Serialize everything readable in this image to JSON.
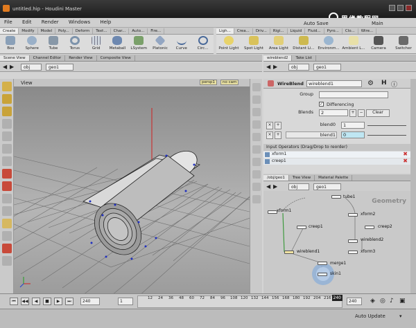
{
  "window": {
    "title": "untitled.hip - Houdini Master"
  },
  "watermark": "思缘教程网",
  "menu": {
    "items": [
      "File",
      "Edit",
      "Render",
      "Windows",
      "Help"
    ],
    "auto_label": "Auto Save",
    "main_label": "Main"
  },
  "shelf_left": {
    "tabs": [
      "Create",
      "Modify",
      "Model",
      "Poly...",
      "Deform",
      "Text...",
      "Char...",
      "Auto...",
      "Fire..."
    ],
    "tools": [
      "Box",
      "Sphere",
      "Tube",
      "Torus",
      "Grid",
      "Metaball",
      "LSystem",
      "Platonic",
      "Curve",
      "Circ..."
    ]
  },
  "shelf_right": {
    "tabs": [
      "Ligh...",
      "Crea...",
      "Driv...",
      "Rigi...",
      "Liquid",
      "Fluid...",
      "Pyro...",
      "Clo...",
      "Wire..."
    ],
    "tools": [
      "Point Light",
      "Spot Light",
      "Area Light",
      "Distant Li...",
      "Environm...",
      "Ambient L...",
      "Camera",
      "Switcher"
    ]
  },
  "scene_tabs": [
    "Scene View",
    "Channel Editor",
    "Render View",
    "Composite View"
  ],
  "scene_path": {
    "obj": "obj",
    "geo": "geo1"
  },
  "view": {
    "label": "View",
    "persp": "persp1",
    "cam": "no cam"
  },
  "param_tabs": [
    "wireblend2",
    "Take List"
  ],
  "param_path": {
    "obj": "obj",
    "geo": "geo1"
  },
  "wireblend": {
    "type": "WireBlend",
    "name": "wireblend1",
    "group_label": "Group",
    "differencing_label": "Differencing",
    "blends_label": "Blends",
    "blends_value": "2",
    "clear_label": "Clear",
    "blend0_label": "blend0",
    "blend0_value": "1",
    "blend1_label": "blend1",
    "blend1_value": "0",
    "inputs_header": "Input Operators (Drag/Drop to reorder)",
    "inputs": [
      "xform1",
      "creep1"
    ]
  },
  "net_tabs": [
    "/obj/geo1",
    "Tree View",
    "Material Palette"
  ],
  "net_path": {
    "obj": "obj",
    "geo": "geo1"
  },
  "network": {
    "context": "Geometry",
    "nodes": [
      "tube1",
      "xform1",
      "xform2",
      "creep1",
      "creep2",
      "wireblend2",
      "wireblend1",
      "xform3",
      "merge1",
      "skin1"
    ]
  },
  "timeline": {
    "start": "1",
    "end": "240",
    "frame": "1",
    "current": "240",
    "ticks": [
      "12",
      "24",
      "36",
      "48",
      "60",
      "72",
      "84",
      "96",
      "108",
      "120",
      "132",
      "144",
      "156",
      "168",
      "180",
      "192",
      "204",
      "216",
      "228"
    ],
    "end_field": "240"
  },
  "status": {
    "auto_update": "Auto Update"
  },
  "colors": {
    "accent": "#e07a1f",
    "selected_node": "#5a8fd0",
    "wire_green": "#3f9a3f"
  }
}
